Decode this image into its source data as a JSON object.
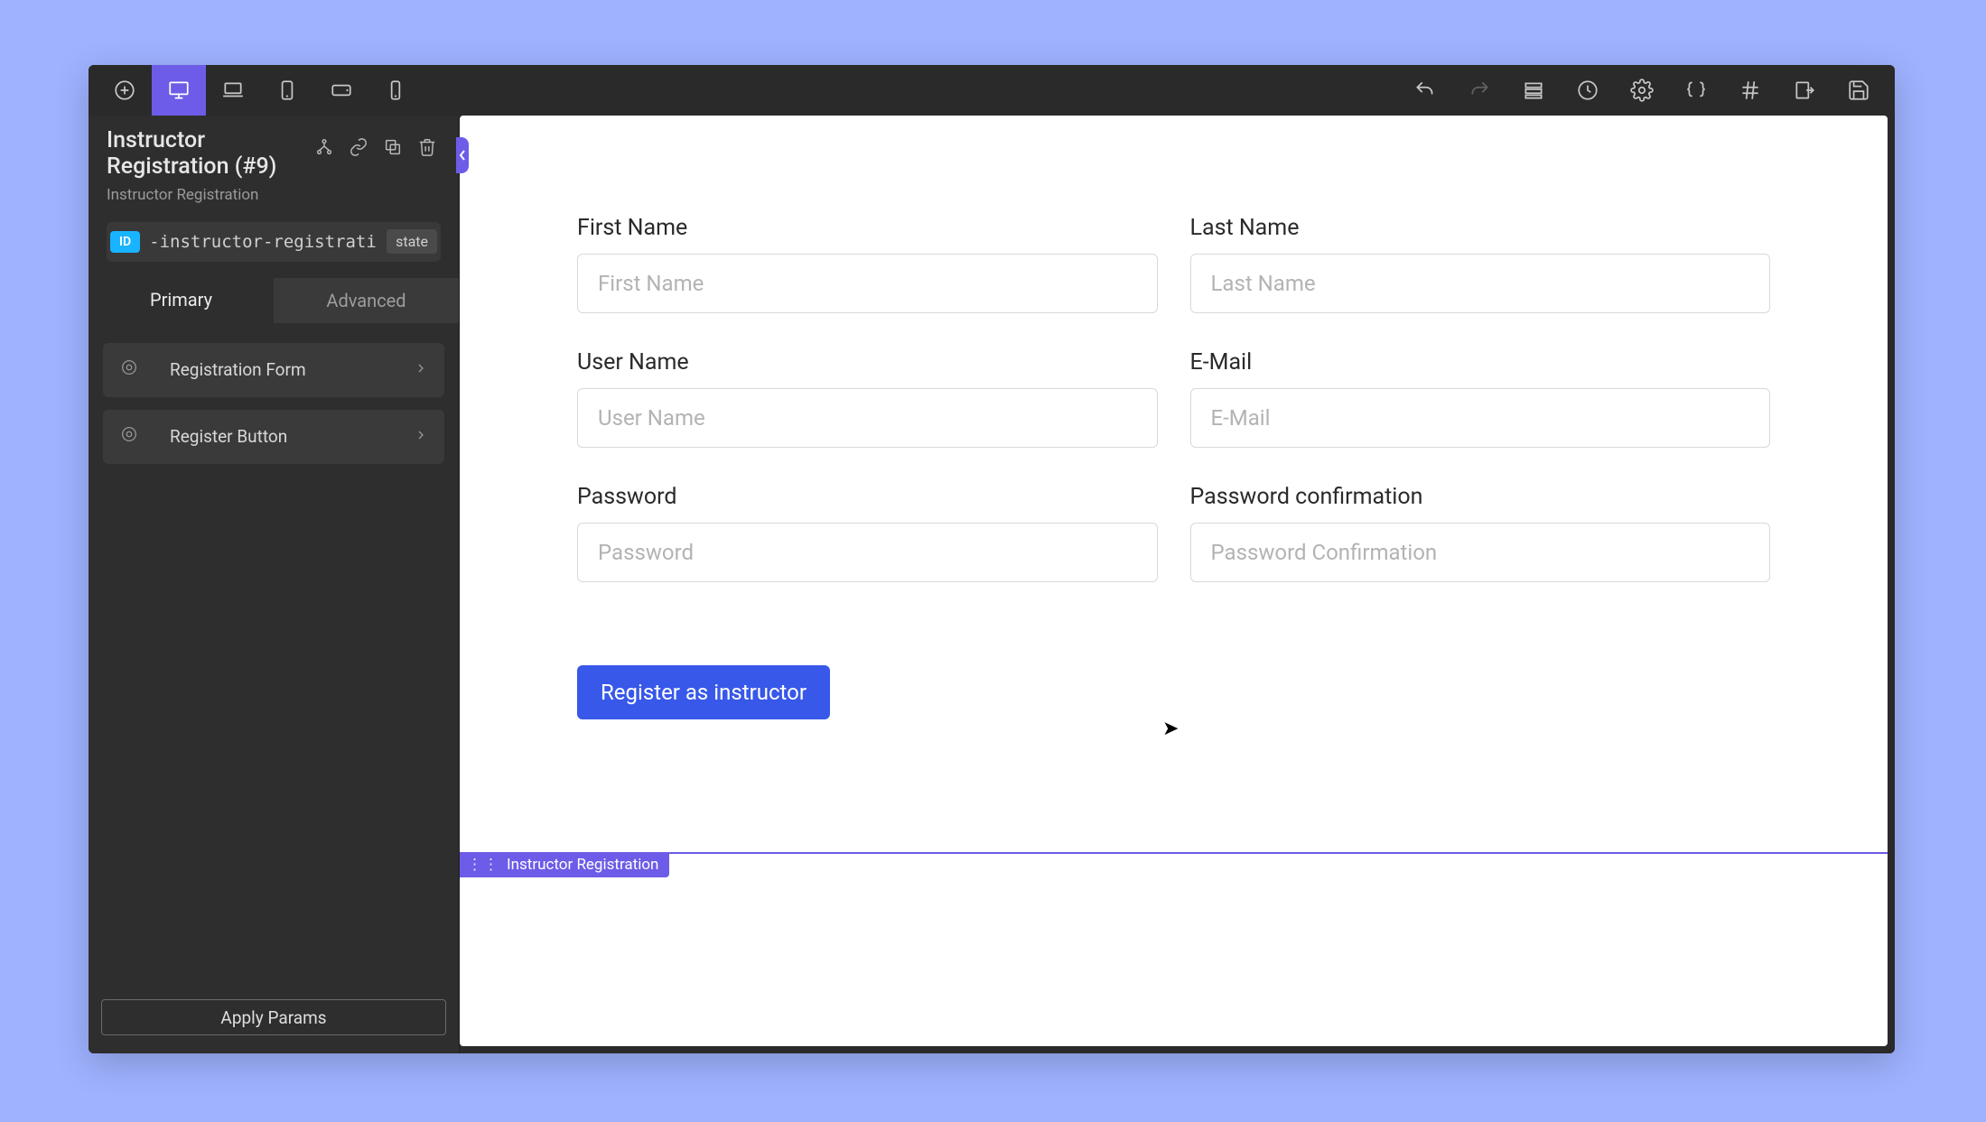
{
  "toolbar": {
    "add_icon": "add",
    "devices": [
      "desktop",
      "laptop",
      "tablet",
      "tablet-landscape",
      "mobile"
    ],
    "active_device": 0,
    "right_icons": [
      "undo",
      "redo",
      "layers",
      "history",
      "settings",
      "code",
      "grid",
      "export",
      "save"
    ]
  },
  "sidebar": {
    "title": "Instructor Registration (#9)",
    "subtitle": "Instructor Registration",
    "id_badge": "ID",
    "id_value": "-instructor-registrati",
    "state_badge": "state",
    "tabs": {
      "primary": "Primary",
      "advanced": "Advanced",
      "active": "primary"
    },
    "controls": [
      {
        "label": "Registration Form"
      },
      {
        "label": "Register Button"
      }
    ],
    "apply_label": "Apply Params",
    "header_icons": [
      "tree",
      "link",
      "duplicate",
      "delete"
    ]
  },
  "canvas": {
    "selection_label": "Instructor Registration",
    "fields": [
      {
        "label": "First Name",
        "placeholder": "First Name",
        "name": "first-name"
      },
      {
        "label": "Last Name",
        "placeholder": "Last Name",
        "name": "last-name"
      },
      {
        "label": "User Name",
        "placeholder": "User Name",
        "name": "user-name"
      },
      {
        "label": "E-Mail",
        "placeholder": "E-Mail",
        "name": "email"
      },
      {
        "label": "Password",
        "placeholder": "Password",
        "name": "password"
      },
      {
        "label": "Password confirmation",
        "placeholder": "Password Confirmation",
        "name": "password-confirmation"
      }
    ],
    "submit_label": "Register as instructor"
  },
  "colors": {
    "accent": "#6c5ce7",
    "primary_button": "#3858e9",
    "id_badge": "#19b4ff"
  }
}
